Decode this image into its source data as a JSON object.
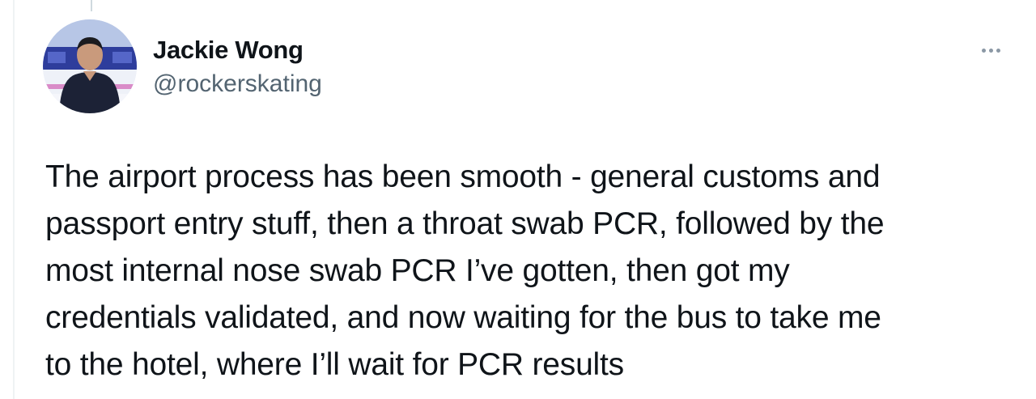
{
  "author": {
    "display_name": "Jackie Wong",
    "handle": "@rockerskating",
    "avatar_icon": "profile-photo"
  },
  "actions": {
    "more_icon": "more-horizontal-icon"
  },
  "tweet": {
    "lines": [
      "The airport process has been smooth - general customs and",
      "passport entry stuff, then a throat swab PCR, followed by the",
      "most internal nose swab PCR I’ve gotten, then got my",
      "credentials validated, and now waiting for the bus to take me",
      "to the hotel, where I’ll wait for PCR results"
    ]
  },
  "colors": {
    "text_primary": "#0f1419",
    "text_secondary": "#536471",
    "divider": "#eff3f4"
  }
}
